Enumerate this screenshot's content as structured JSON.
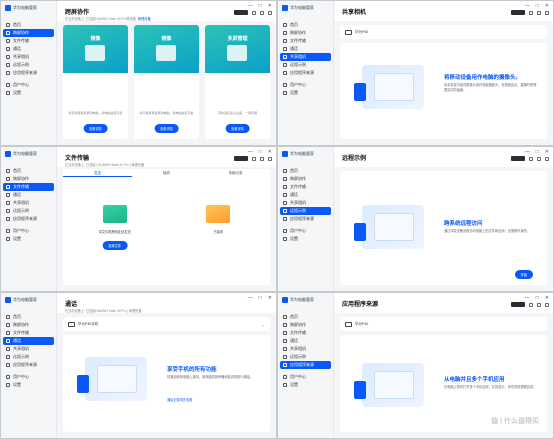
{
  "app": {
    "name": "华为电脑管家"
  },
  "colors": {
    "accent": "#0a59f7",
    "sidebar": "#f5f6f8",
    "content_bg": "#f4f5f7"
  },
  "window_controls": [
    "—",
    "□",
    "✕"
  ],
  "nav_main": [
    {
      "label": "首页",
      "icon": "home-icon"
    },
    {
      "label": "跨屏协作",
      "icon": "multi-screen-icon"
    },
    {
      "label": "文件传输",
      "icon": "file-transfer-icon"
    },
    {
      "label": "通话",
      "icon": "phone-icon"
    },
    {
      "label": "共享相机",
      "icon": "camera-icon"
    },
    {
      "label": "远程示例",
      "icon": "remote-icon"
    },
    {
      "label": "应用程序来源",
      "icon": "apps-icon"
    }
  ],
  "nav_bottom": [
    {
      "label": "用户中心",
      "icon": "user-icon"
    },
    {
      "label": "设置",
      "icon": "settings-icon"
    }
  ],
  "w1": {
    "title": "跨屏协作",
    "info": "在当前设备上: 已连接HUAWEI Mate 40 Pro等设备",
    "info_link": "管理设备",
    "cards": [
      {
        "name": "镜像",
        "desc": "将手机屏幕投屏到电脑，用电脑操控手机",
        "button": "查看详情"
      },
      {
        "name": "镜像",
        "desc": "将平板屏幕投屏到电脑，用电脑操控平板",
        "button": "查看详情"
      },
      {
        "name": "多屏管理",
        "desc": "同时连接多台设备，一屏管理",
        "button": "查看详情"
      }
    ]
  },
  "w2": {
    "title": "共享相机",
    "device": "华为P40",
    "promo_title": "将移动设备用作电脑的摄像头。",
    "promo_desc": "将手机或平板的摄像头用作电脑摄像头，在视频会议、直播时获得更高清的画面。",
    "promo_sub": ""
  },
  "w3": {
    "title": "文件传输",
    "info": "在当前设备上: 已连接 | HUAWEI Mate 40 Pro | 管理设备",
    "tabs": [
      "发送",
      "接收",
      "传输记录"
    ],
    "tab_link": "查看传输记录",
    "left_label": "将文件拖拽到此处发送",
    "left_button": "选择文件",
    "right_label": "已接收"
  },
  "w4": {
    "title": "远程示例",
    "promo_title": "跨系统远程访问",
    "promo_desc": "通过鸿蒙设备远程访问电脑上的文件和应用，无需额外操作。",
    "button": "开始"
  },
  "w5": {
    "title": "通话",
    "info": "在当前设备上: 已连接HUAWEI Mate 40 Pro | 管理设备",
    "device": "华为P40手机",
    "promo_title": "享受手机的所有功能",
    "promo_desc": "将通话转到电脑上接听，用电脑的扬声器和麦克风进行通话。",
    "promo_sub": "通话记录同步查看"
  },
  "w6": {
    "title": "应用程序来源",
    "device": "华为P40",
    "promo_title": "从电脑并且多个手机应用",
    "promo_desc": "在电脑上同时打开多个手机应用，并排显示，多任务处理更高效。"
  },
  "watermark": "值 | 什么值得买"
}
